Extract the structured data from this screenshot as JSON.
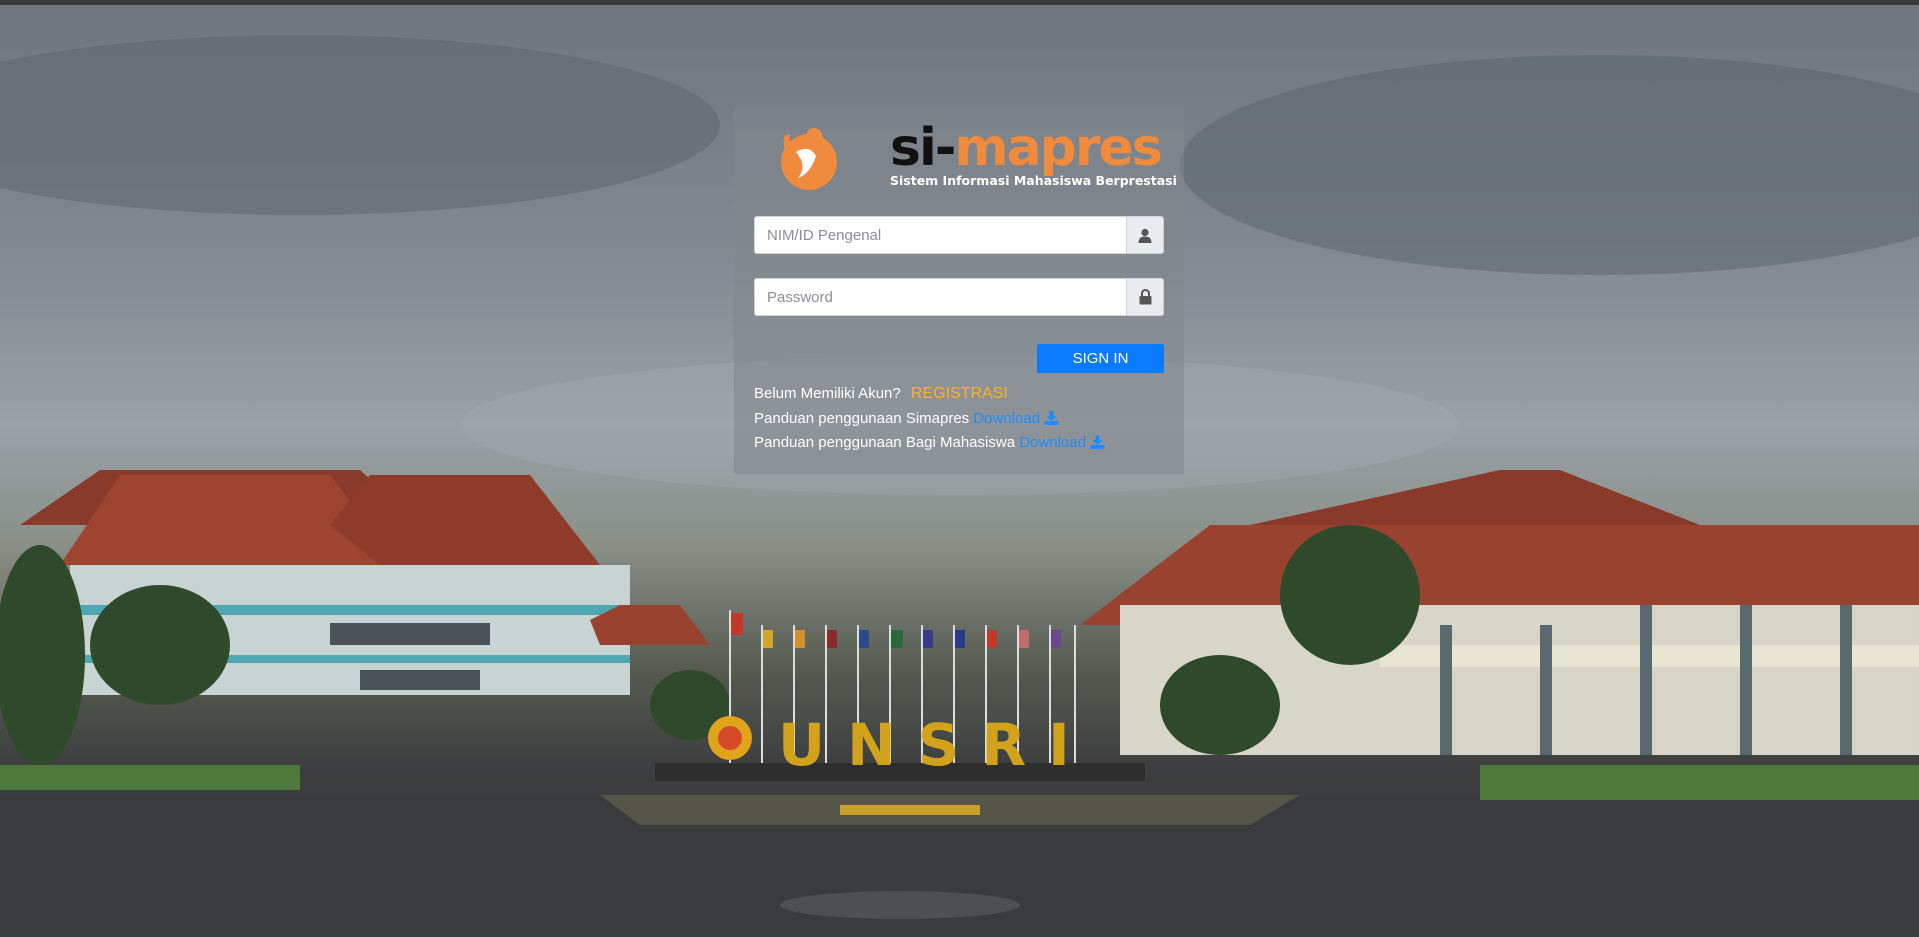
{
  "logo": {
    "word_si": "si-",
    "word_mapres": "mapres",
    "subtitle": "Sistem Informasi Mahasiswa Berprestasi"
  },
  "login": {
    "username_placeholder": "NIM/ID Pengenal",
    "password_placeholder": "Password",
    "signin_label": "SIGN IN"
  },
  "links": {
    "no_account_text": "Belum Memiliki Akun?",
    "register_label": "REGISTRASI",
    "guide_simapres_text": "Panduan penggunaan Simapres",
    "guide_mahasiswa_text": "Panduan penggunaan Bagi Mahasiswa",
    "download_label": "Download"
  },
  "background": {
    "sign_letters": "UNSRI"
  },
  "colors": {
    "brand_orange": "#f08a3c",
    "signin_blue": "#0a7bff",
    "register_orange": "#ffb21e",
    "download_blue": "#1e8cff"
  },
  "icons": {
    "username": "user-icon",
    "password": "lock-icon",
    "download": "download-icon"
  }
}
